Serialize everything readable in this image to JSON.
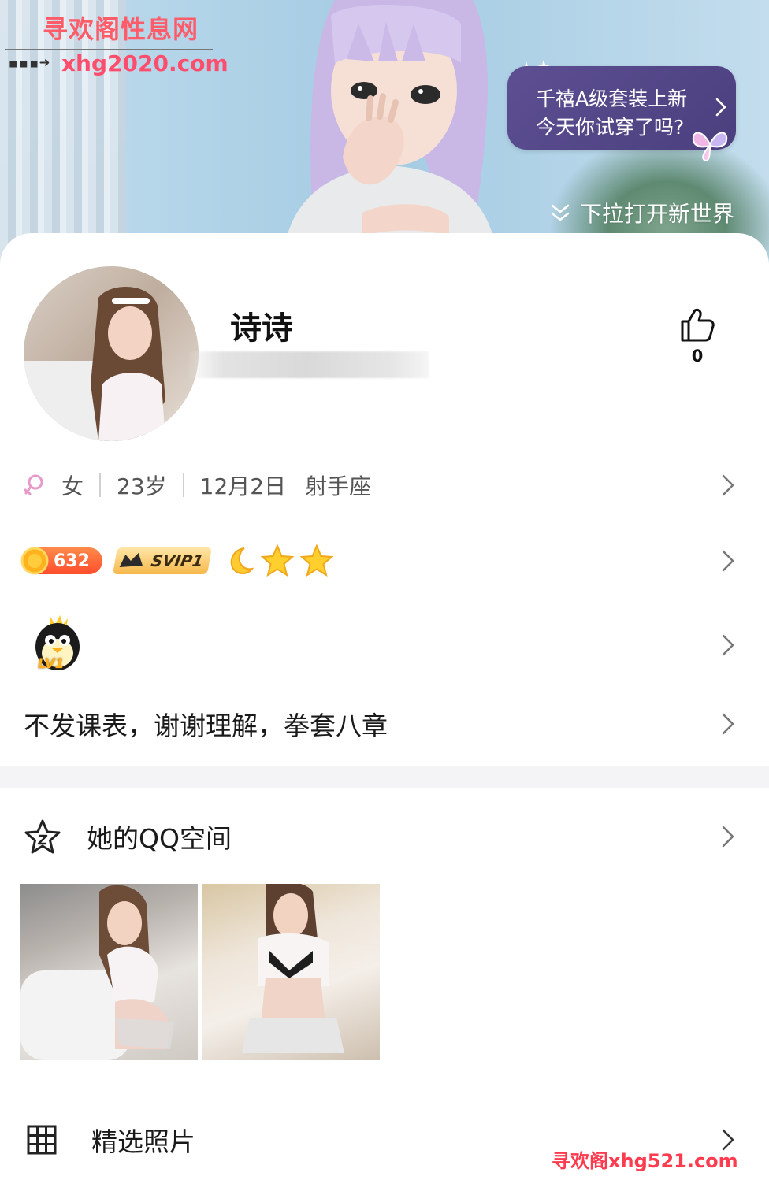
{
  "watermark": {
    "site_name": "寻欢阁性息网",
    "site_url": "xhg2020.com",
    "bottom_text": "寻欢阁xhg521.com"
  },
  "banner": {
    "promo_line1": "千禧A级套装上新",
    "promo_line2": "今天你试穿了吗?",
    "pull_hint": "下拉打开新世界"
  },
  "profile": {
    "name": "诗诗",
    "likes": "0"
  },
  "info": {
    "gender": "女",
    "age": "23岁",
    "birthday": "12月2日",
    "zodiac": "射手座"
  },
  "badges": {
    "coin_count": "632",
    "vip_label": "SVIP1"
  },
  "qq_level": {
    "label": "LV1"
  },
  "signature": "不发课表，谢谢理解，拳套八章",
  "qzone": {
    "title": "她的QQ空间"
  },
  "featured": {
    "title": "精选照片"
  },
  "colors": {
    "accent_pink": "#ff5c6a",
    "promo_bg": "#4b3f7e",
    "gender_icon": "#e79ac9",
    "divider": "#f4f4f6"
  }
}
